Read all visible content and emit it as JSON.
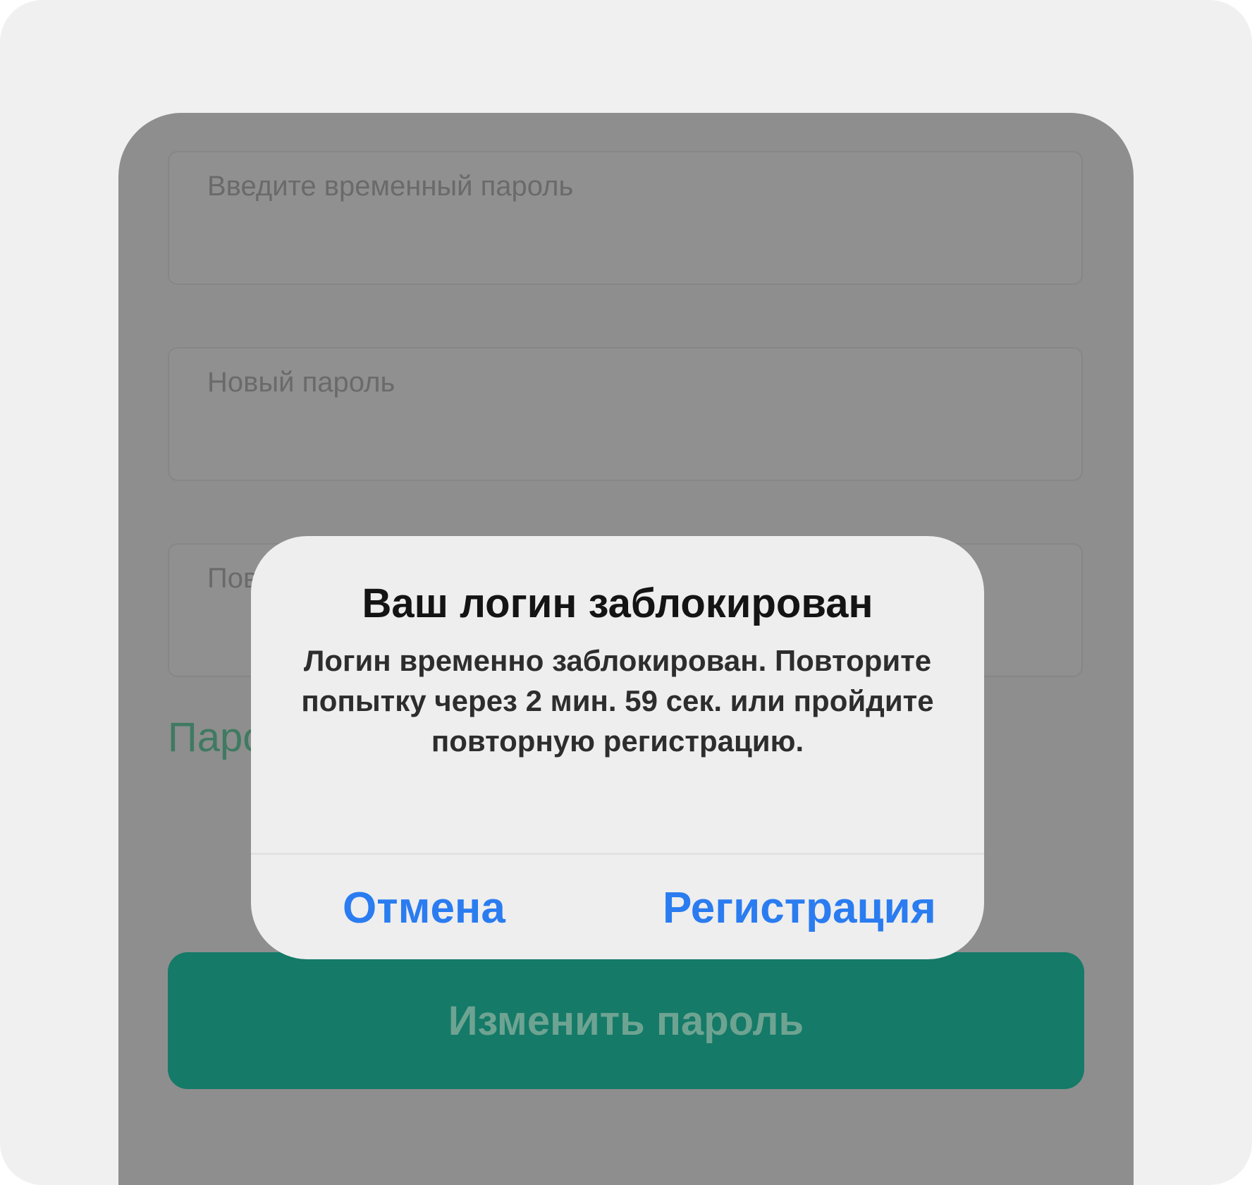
{
  "form": {
    "temp_password_placeholder": "Введите временный пароль",
    "new_password_placeholder": "Новый пароль",
    "repeat_password_placeholder": "Пов",
    "rules_link_partial": "Паро",
    "submit_label": "Изменить пароль"
  },
  "alert": {
    "title": "Ваш логин заблокирован",
    "message": "Логин временно заблокирован. Повторите попытку через 2 мин. 59 сек. или пройдите повторную регистрацию.",
    "cancel_label": "Отмена",
    "register_label": "Регистрация"
  },
  "colors": {
    "accent_green": "#157a68",
    "link_blue": "#2a7cf0",
    "overlay": "#8e8e8e"
  }
}
